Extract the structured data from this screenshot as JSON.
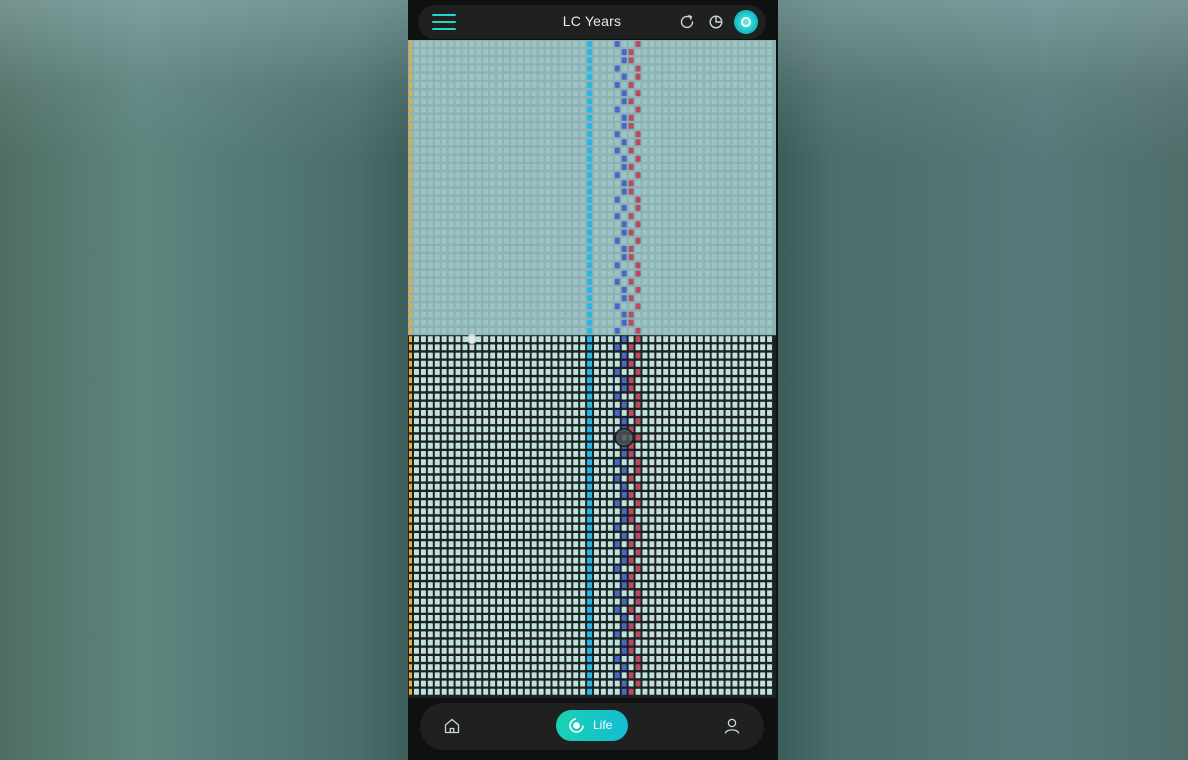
{
  "app": {
    "title": "LC Years"
  },
  "top_bar": {
    "menu_icon": "menu-icon",
    "refresh_icon": "refresh-icon",
    "clock_icon": "clock-icon",
    "logo_icon": "logo-icon"
  },
  "life_grid": {
    "columns": 52,
    "rows": 80,
    "lived_rows": 36,
    "current_week": {
      "row": 36,
      "column": 8
    },
    "marked_week": {
      "row": 48,
      "column": 30
    },
    "highlight_column": 25,
    "colors": {
      "lived": "#9ec3c3",
      "future": "#bfe0dc",
      "background": "#1c2222",
      "lived_background": "#8bb3b3",
      "left_edge": "#f0a63c",
      "highlight_column": "#29b6e6",
      "blue_marks": "#4a66c8",
      "red_marks": "#b84b63"
    }
  },
  "bottom_nav": {
    "home_icon": "home-icon",
    "life_label": "Life",
    "life_icon": "life-icon",
    "profile_icon": "profile-icon"
  }
}
